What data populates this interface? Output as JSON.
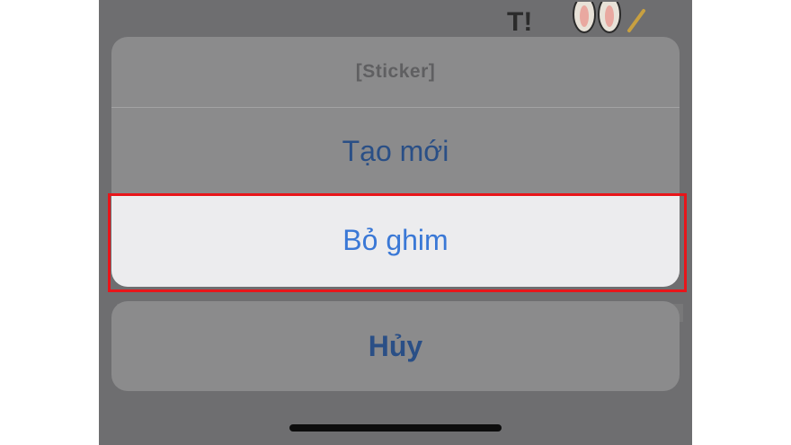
{
  "action_sheet": {
    "title": "[Sticker]",
    "actions": [
      {
        "label": "Tạo mới"
      },
      {
        "label": "Bỏ ghim",
        "highlighted": true
      }
    ],
    "cancel_label": "Hủy"
  },
  "colors": {
    "overlay": "#6e6e70",
    "sheet_dimmed": "#8b8b8c",
    "action_text": "#2a4f86",
    "active_action_text": "#3a78d6",
    "highlight_border": "#e8151a",
    "home_indicator": "#0d0d0d"
  },
  "icons": {
    "background_sticker": "rabbit-sticker-icon"
  }
}
